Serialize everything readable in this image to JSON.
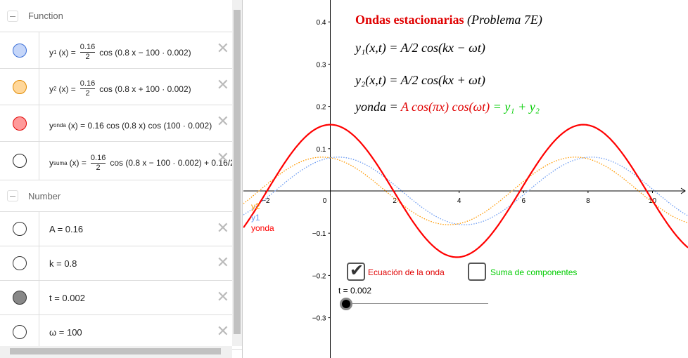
{
  "algebra": {
    "function_header": "Function",
    "functions": [
      {
        "name": "y1",
        "color": "#c5d6f9",
        "border": "#3b6fd6",
        "lhs": "y",
        "sub": "1",
        "pre": "(x) = ",
        "num": "0.16",
        "den": "2",
        "post": "cos (0.8 x − 100 · 0.002)"
      },
      {
        "name": "y2",
        "color": "#ffd79a",
        "border": "#e08a00",
        "lhs": "y",
        "sub": "2",
        "pre": "(x) = ",
        "num": "0.16",
        "den": "2",
        "post": "cos (0.8 x + 100 · 0.002)"
      },
      {
        "name": "yonda",
        "color": "#ff9a9a",
        "border": "#e00000",
        "lhs": "y",
        "sub": "onda",
        "pre": "(x) = 0.16  cos (0.8 x)  cos (100 · 0.002)",
        "num": "",
        "den": "",
        "post": ""
      },
      {
        "name": "ysuma",
        "color": "#ffffff",
        "border": "#222",
        "lhs": "y",
        "sub": "suma",
        "pre": "(x) = ",
        "num": "0.16",
        "den": "2",
        "post": "cos (0.8 x − 100 · 0.002) + 0.16/2"
      }
    ],
    "number_header": "Number",
    "numbers": [
      {
        "text": "A = 0.16",
        "color": "#ffffff"
      },
      {
        "text": "k = 0.8",
        "color": "#ffffff"
      },
      {
        "text": "t = 0.002",
        "color": "#888888"
      },
      {
        "text": "ω = 100",
        "color": "#ffffff"
      }
    ]
  },
  "graph": {
    "title": "Ondas estacionarias",
    "title_suffix": "(Problema 7E)",
    "eq1": "y₁(x,t) = A/2 cos(kx − ωt)",
    "eq2": "y₂(x,t) = A/2 cos(kx + ωt)",
    "eq3_lhs": "yonda = ",
    "eq3_mid": "A cos(πx) cos(ωt)",
    "eq3_rhs": " = y₁ + y₂",
    "checkbox1": {
      "label": "Ecuación de la onda",
      "checked": true
    },
    "checkbox2": {
      "label": "Suma de componentes",
      "checked": false
    },
    "slider_label": "t = 0.002",
    "slider_value": 0.002,
    "curve_labels": {
      "y1": "y1",
      "y2": "y2",
      "yonda": "yonda"
    },
    "colors": {
      "y1": "#6b9bf2",
      "y2": "#ff9900",
      "yonda": "#ff0000",
      "green": "#00cc00"
    }
  },
  "chart_data": {
    "type": "line",
    "xlim": [
      -2.5,
      11
    ],
    "ylim": [
      -0.35,
      0.44
    ],
    "x_ticks": [
      -2,
      0,
      2,
      4,
      6,
      8,
      10
    ],
    "y_ticks": [
      -0.3,
      -0.2,
      -0.1,
      0.1,
      0.2,
      0.3,
      0.4
    ],
    "series": [
      {
        "name": "y1",
        "expr": "0.08*cos(0.8x-0.2)",
        "style": "dotted"
      },
      {
        "name": "y2",
        "expr": "0.08*cos(0.8x+0.2)",
        "style": "dotted"
      },
      {
        "name": "yonda",
        "expr": "0.16*cos(0.8x)*cos(0.2)",
        "style": "solid"
      }
    ]
  }
}
